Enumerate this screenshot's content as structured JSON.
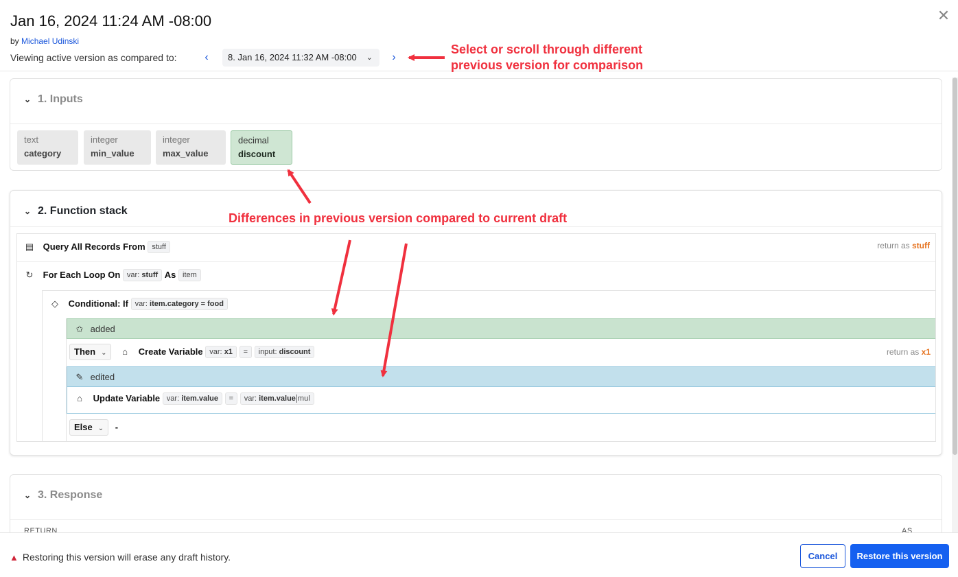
{
  "header": {
    "title": "Jan 16, 2024 11:24 AM -08:00",
    "by_prefix": "by",
    "author": "Michael Udinski",
    "compare_label": "Viewing active version as compared to:",
    "selected_version": "8. Jan 16, 2024 11:32 AM -08:00",
    "close_icon": "close-icon",
    "prev_icon": "chevron-left-icon",
    "next_icon": "chevron-right-icon"
  },
  "annotations": {
    "version_nav": "Select or scroll through different previous version for comparison",
    "version_nav_line1": "Select or scroll through different",
    "version_nav_line2": "previous version for comparison",
    "differences": "Differences in previous version compared to current draft",
    "color": "#f0303e"
  },
  "inputs": {
    "heading": "1. Inputs",
    "items": [
      {
        "type": "text",
        "name": "category",
        "added": false
      },
      {
        "type": "integer",
        "name": "min_value",
        "added": false
      },
      {
        "type": "integer",
        "name": "max_value",
        "added": false
      },
      {
        "type": "decimal",
        "name": "discount",
        "added": true
      }
    ]
  },
  "function_stack": {
    "heading": "2. Function stack",
    "query": {
      "label": "Query All Records From",
      "table": "stuff",
      "return_prefix": "return as",
      "return_var": "stuff",
      "icon": "table-icon"
    },
    "loop": {
      "label": "For Each Loop On",
      "var_prefix": "var:",
      "var": "stuff",
      "as_label": "As",
      "item": "item",
      "icon": "loop-icon"
    },
    "conditional": {
      "label": "Conditional: If",
      "var_prefix": "var:",
      "expr": "item.category = food",
      "icon": "diamond-icon"
    },
    "added_band": {
      "label": "added",
      "icon": "sparkle-icon",
      "color": "#c9e3cf"
    },
    "then": {
      "branch": "Then",
      "label": "Create Variable",
      "var_prefix": "var:",
      "var": "x1",
      "eq": "=",
      "value_prefix": "input:",
      "value": "discount",
      "return_prefix": "return as",
      "return_var": "x1",
      "icon": "tag-icon"
    },
    "edited_band": {
      "label": "edited",
      "icon": "edit-icon",
      "color": "#c2e0ec"
    },
    "update": {
      "label": "Update Variable",
      "var_prefix": "var:",
      "var": "item.value",
      "eq": "=",
      "value_prefix": "var:",
      "value": "item.value",
      "value_suffix": "mul",
      "icon": "tag-icon"
    },
    "else": {
      "branch": "Else",
      "value": "-"
    }
  },
  "response": {
    "heading": "3. Response",
    "col_return": "RETURN",
    "col_as": "AS"
  },
  "footer": {
    "warning": "Restoring this version will erase any draft history.",
    "warning_icon": "warning-icon",
    "cancel": "Cancel",
    "restore": "Restore this version",
    "primary_color": "#1560f0"
  }
}
